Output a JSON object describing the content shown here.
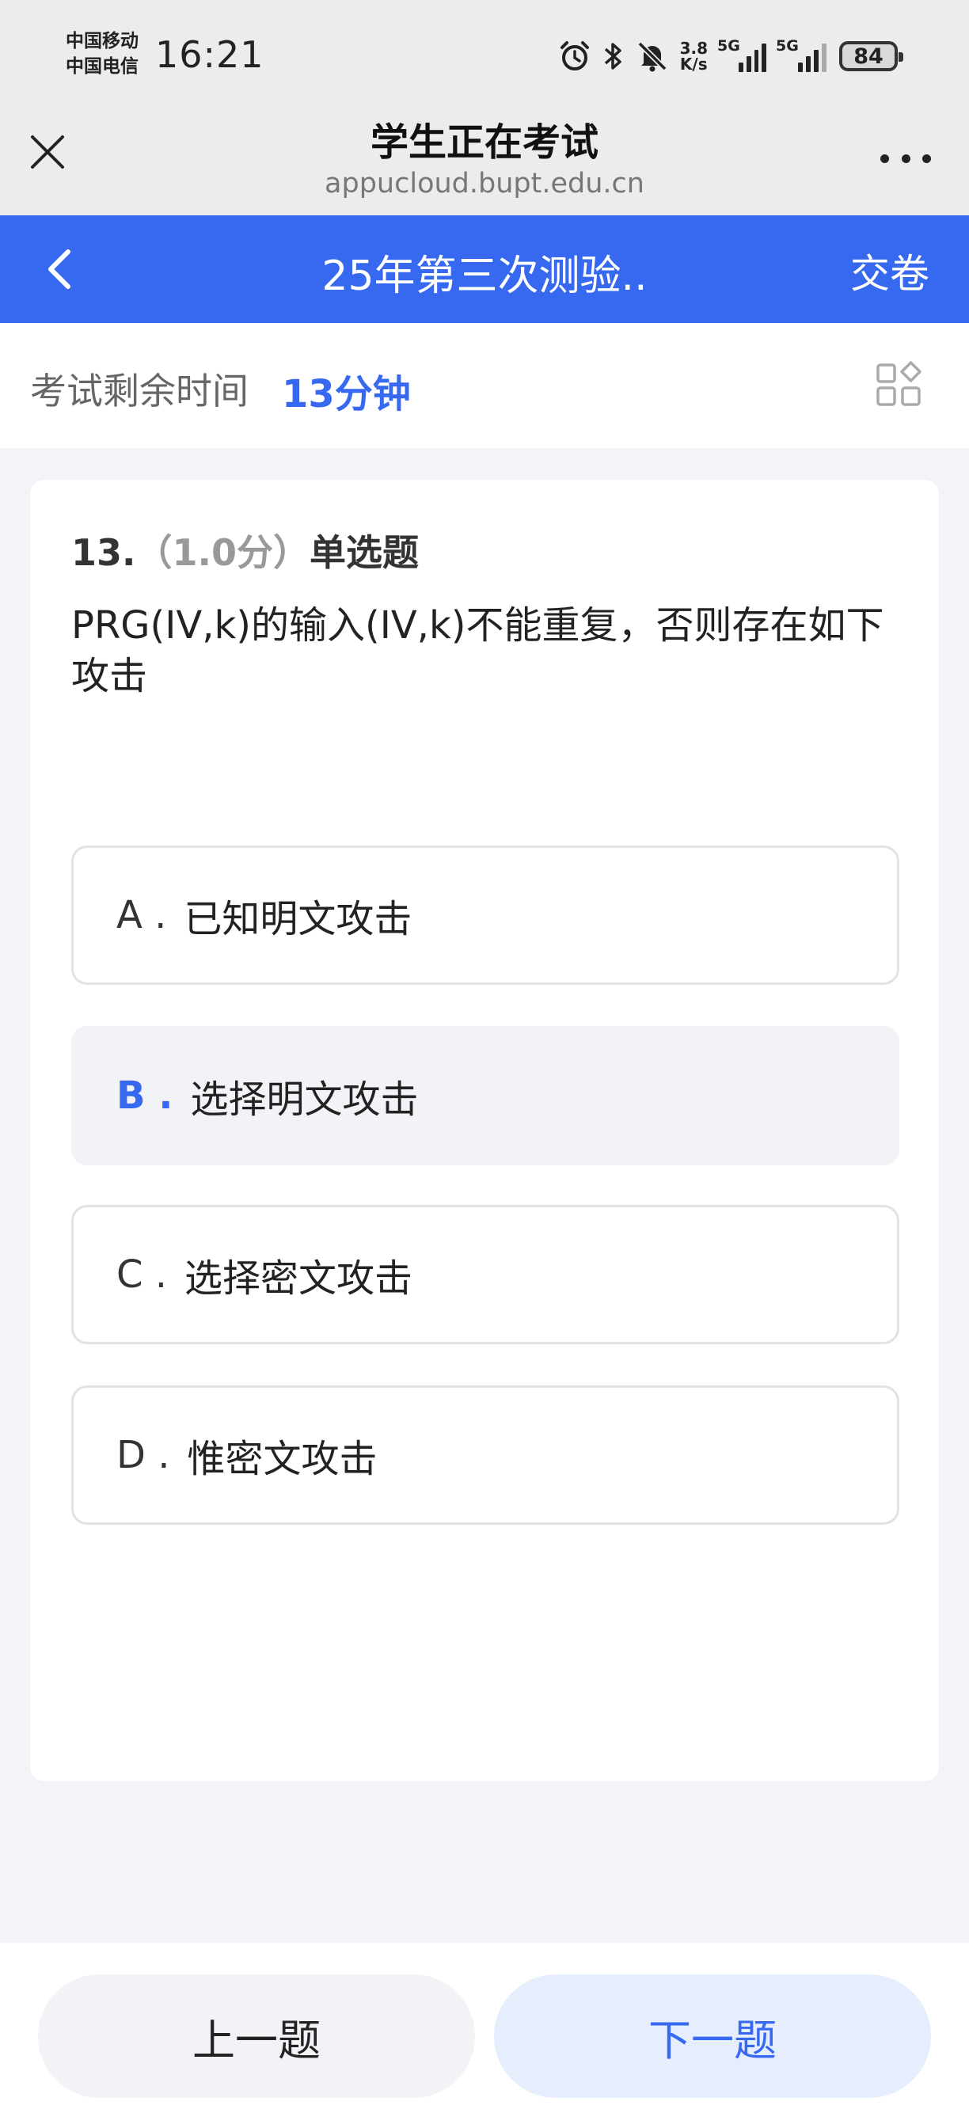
{
  "status_bar": {
    "carrier_1": "中国移动",
    "carrier_2": "中国电信",
    "time": "16:21",
    "net_speed_value": "3.8",
    "net_speed_unit": "K/s",
    "signal_1_label": "5G",
    "signal_2_label": "5G",
    "battery": "84",
    "icons": [
      "alarm-icon",
      "bluetooth-icon",
      "mute-icon"
    ]
  },
  "browser": {
    "title": "学生正在考试",
    "url": "appucloud.bupt.edu.cn"
  },
  "appbar": {
    "exam_title": "25年第三次测验..",
    "submit_label": "交卷"
  },
  "timer": {
    "label": "考试剩余时间",
    "value": "13分钟"
  },
  "question": {
    "number": "13.",
    "score": "（1.0分）",
    "type": "单选题",
    "text": "PRG(IV,k)的输入(IV,k)不能重复，否则存在如下攻击",
    "selected": "B",
    "options": [
      {
        "key": "A .",
        "text": "已知明文攻击"
      },
      {
        "key": "B .",
        "text": "选择明文攻击"
      },
      {
        "key": "C .",
        "text": "选择密文攻击"
      },
      {
        "key": "D .",
        "text": "惟密文攻击"
      }
    ]
  },
  "nav": {
    "prev_label": "上一题",
    "next_label": "下一题"
  },
  "colors": {
    "accent": "#3669f0",
    "page_bg": "#f3f4f8",
    "selected_option_bg": "#f2f3f7",
    "next_button_bg": "#e6edfd"
  }
}
